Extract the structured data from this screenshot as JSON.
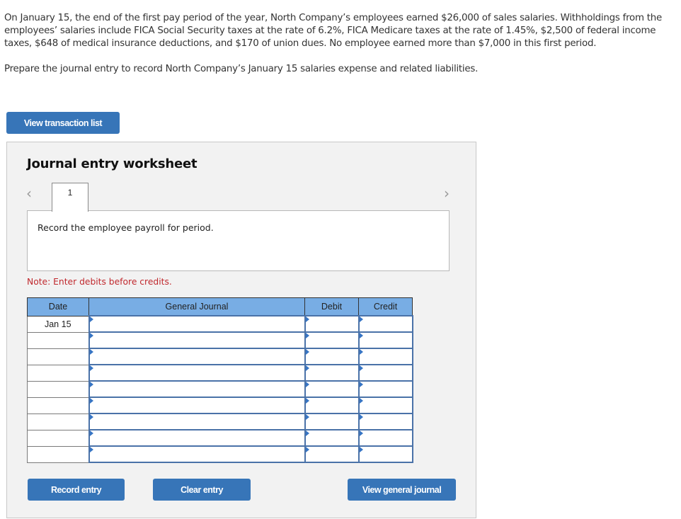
{
  "problem": {
    "paragraph": "On January 15, the end of the first pay period of the year, North Company’s employees earned $26,000 of sales salaries. Withholdings from the employees’ salaries include FICA Social Security taxes at the rate of 6.2%, FICA Medicare taxes at the rate of 1.45%, $2,500 of federal income taxes, $648 of medical insurance deductions, and $170 of union dues. No employee earned more than $7,000 in this first period.",
    "instruction": "Prepare the journal entry to record North Company’s January 15 salaries expense and related liabilities."
  },
  "buttons": {
    "view_transaction_list": "View transaction list",
    "record_entry": "Record entry",
    "clear_entry": "Clear entry",
    "view_general_journal": "View general journal"
  },
  "worksheet": {
    "title": "Journal entry worksheet",
    "prev_icon": "‹",
    "next_icon": "›",
    "current_tab": "1",
    "description": "Record the employee payroll for period.",
    "note": "Note: Enter debits before credits."
  },
  "journal": {
    "headers": {
      "date": "Date",
      "general_journal": "General Journal",
      "debit": "Debit",
      "credit": "Credit"
    },
    "rows": [
      {
        "date": "Jan 15",
        "account": "",
        "debit": "",
        "credit": ""
      },
      {
        "date": "",
        "account": "",
        "debit": "",
        "credit": ""
      },
      {
        "date": "",
        "account": "",
        "debit": "",
        "credit": ""
      },
      {
        "date": "",
        "account": "",
        "debit": "",
        "credit": ""
      },
      {
        "date": "",
        "account": "",
        "debit": "",
        "credit": ""
      },
      {
        "date": "",
        "account": "",
        "debit": "",
        "credit": ""
      },
      {
        "date": "",
        "account": "",
        "debit": "",
        "credit": ""
      },
      {
        "date": "",
        "account": "",
        "debit": "",
        "credit": ""
      },
      {
        "date": "",
        "account": "",
        "debit": "",
        "credit": ""
      }
    ]
  },
  "colors": {
    "button_blue": "#3775b8",
    "header_blue": "#78ade4",
    "note_red": "#c0282d",
    "panel_gray": "#f2f2f2"
  }
}
